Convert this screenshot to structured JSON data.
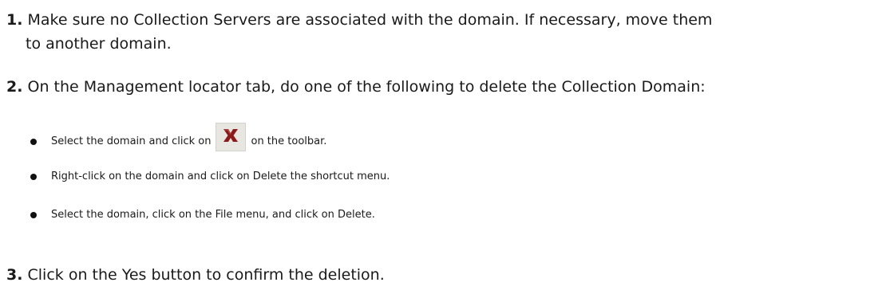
{
  "steps": [
    {
      "number": "1.",
      "text_line1": "Make sure no Collection Servers are associated with the domain. If necessary, move them",
      "text_line2": "to another domain."
    },
    {
      "number": "2.",
      "text": "On the Management locator tab, do one of the following to delete the Collection Domain:"
    },
    {
      "number": "3.",
      "text": "Click on the Yes button to confirm the deletion."
    }
  ],
  "bullets": [
    {
      "text_before": "Select the domain and click on",
      "icon": "delete-x-icon",
      "text_after": "on the toolbar."
    },
    {
      "text": "Right-click on the domain and click on Delete the shortcut menu."
    },
    {
      "text": "Select the domain, click on the File menu, and click on Delete."
    }
  ],
  "colors": {
    "icon_x": "#8b1a1a",
    "icon_bg": "#e8e6e1",
    "text": "#1a1a1a"
  }
}
